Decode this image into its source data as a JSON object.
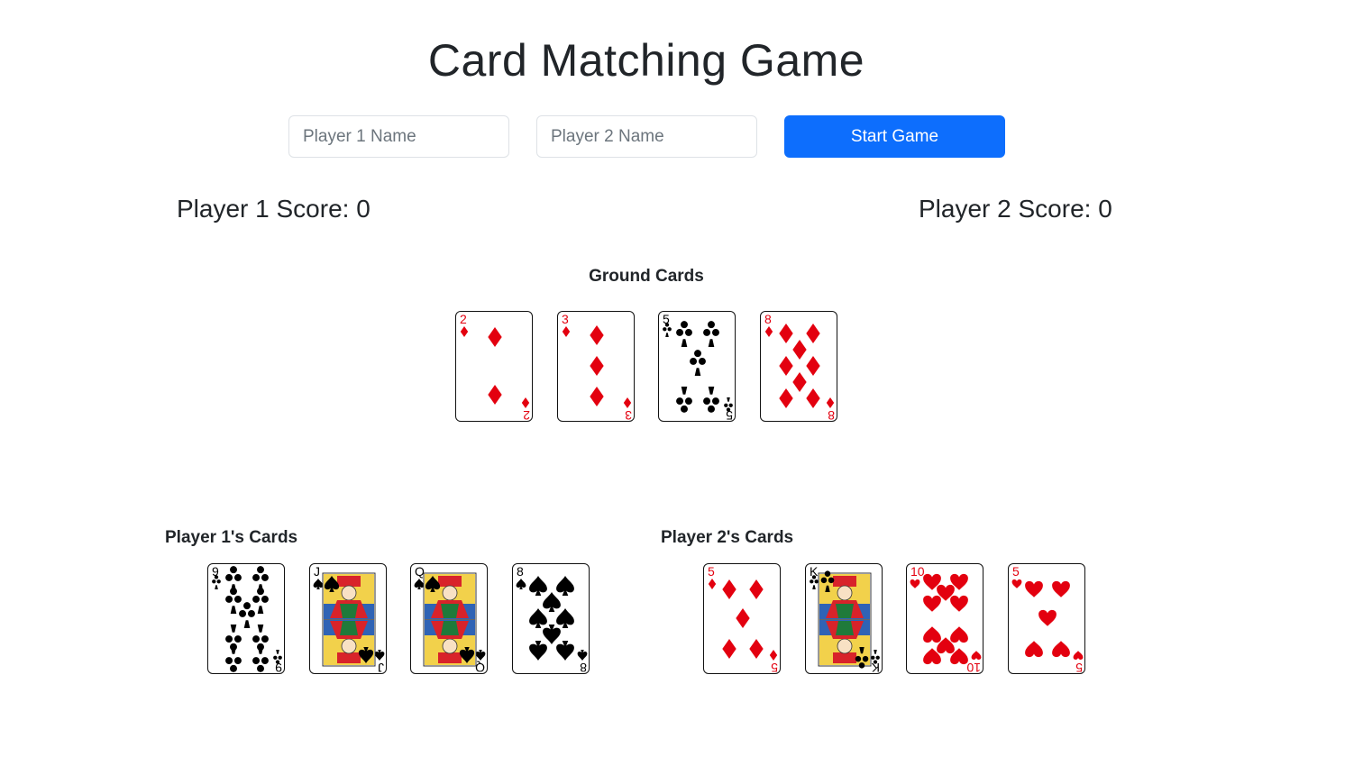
{
  "title": "Card Matching Game",
  "inputs": {
    "player1_placeholder": "Player 1 Name",
    "player2_placeholder": "Player 2 Name",
    "player1_value": "",
    "player2_value": ""
  },
  "start_button_label": "Start Game",
  "scores": {
    "player1": "Player 1 Score: 0",
    "player2": "Player 2 Score: 0"
  },
  "ground": {
    "label": "Ground Cards",
    "cards": [
      {
        "rank": "2",
        "suit": "diamond"
      },
      {
        "rank": "3",
        "suit": "diamond"
      },
      {
        "rank": "5",
        "suit": "club"
      },
      {
        "rank": "8",
        "suit": "diamond"
      }
    ]
  },
  "player1_hand": {
    "label": "Player 1's Cards",
    "cards": [
      {
        "rank": "9",
        "suit": "club"
      },
      {
        "rank": "J",
        "suit": "spade"
      },
      {
        "rank": "Q",
        "suit": "spade"
      },
      {
        "rank": "8",
        "suit": "spade"
      }
    ]
  },
  "player2_hand": {
    "label": "Player 2's Cards",
    "cards": [
      {
        "rank": "5",
        "suit": "diamond"
      },
      {
        "rank": "K",
        "suit": "club"
      },
      {
        "rank": "10",
        "suit": "heart"
      },
      {
        "rank": "5",
        "suit": "heart"
      }
    ]
  },
  "colors": {
    "accent": "#0d6efd",
    "red_suit": "#e3000f",
    "black_suit": "#000000",
    "text": "#212529"
  }
}
